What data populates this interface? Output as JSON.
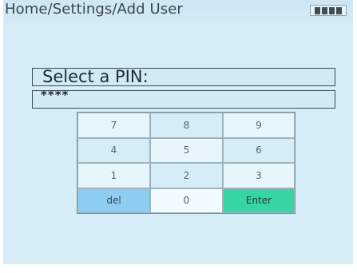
{
  "header": {
    "breadcrumb": "Home/Settings/Add User",
    "battery_icon": "battery-full-icon"
  },
  "pin_panel": {
    "title": "Select a PIN:",
    "masked_value": "****"
  },
  "keypad": {
    "keys": [
      "7",
      "8",
      "9",
      "4",
      "5",
      "6",
      "1",
      "2",
      "3",
      "del",
      "0",
      "Enter"
    ]
  },
  "colors": {
    "screen_background": "#d6ecf7",
    "del_key": "#8ccdf0",
    "enter_key": "#37d5a5"
  }
}
